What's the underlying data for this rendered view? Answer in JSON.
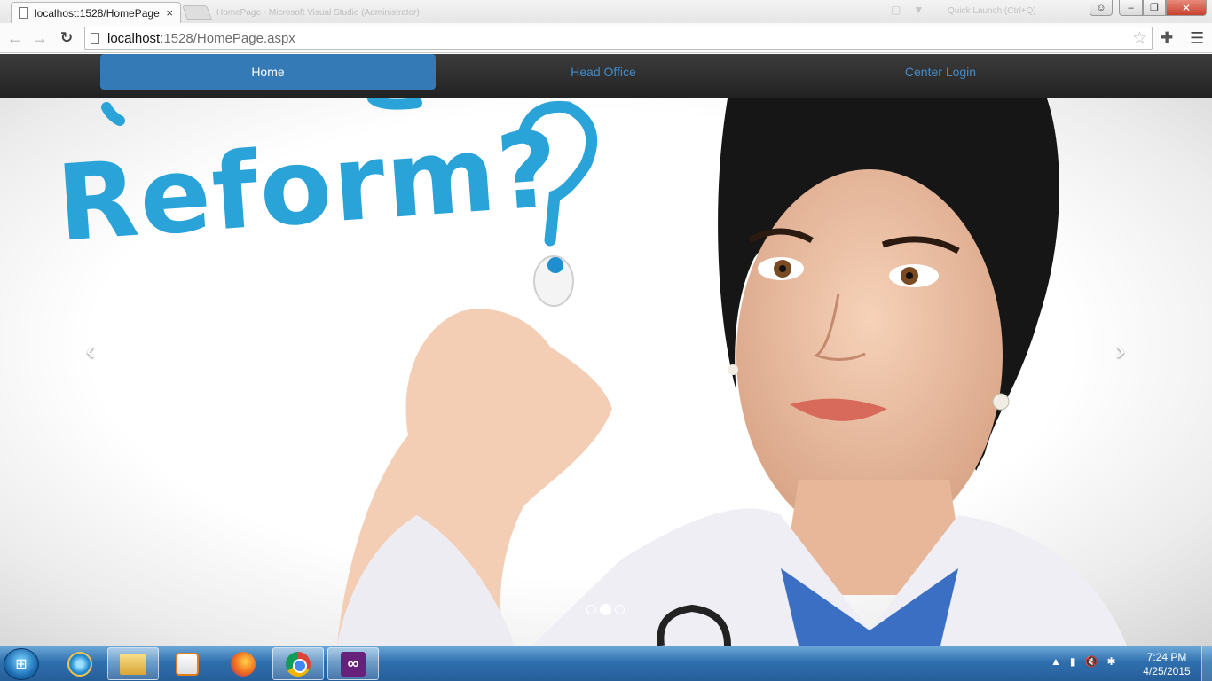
{
  "browser": {
    "tab_title": "localhost:1528/HomePage",
    "tab_close": "×",
    "background_window_text": "HomePage - Microsoft Visual Studio (Administrator)",
    "search_hint": "Quick Launch (Ctrl+Q)",
    "url_host": "localhost",
    "url_path": ":1528/HomePage.aspx",
    "icons": [
      "back-arrow-icon",
      "forward-arrow-icon",
      "reload-icon",
      "page-icon",
      "star-icon",
      "extension-icon",
      "menu-icon"
    ]
  },
  "site_nav": {
    "items": [
      {
        "label": "Home",
        "active": true
      },
      {
        "label": "Head Office",
        "active": false
      },
      {
        "label": "Center Login",
        "active": false
      }
    ],
    "active_color": "#337ab7",
    "link_color": "#428bca"
  },
  "carousel": {
    "caption_text": "Reform?",
    "caption_color": "#2aa4d8",
    "prev_label": "‹",
    "next_label": "›",
    "slide_count": 3,
    "active_index": 1
  },
  "taskbar": {
    "apps": [
      "Internet Explorer",
      "Windows Explorer",
      "Windows Media Player",
      "Firefox",
      "Chrome",
      "Visual Studio"
    ],
    "active_app": "Chrome",
    "time": "7:24 PM",
    "date": "4/25/2015"
  }
}
